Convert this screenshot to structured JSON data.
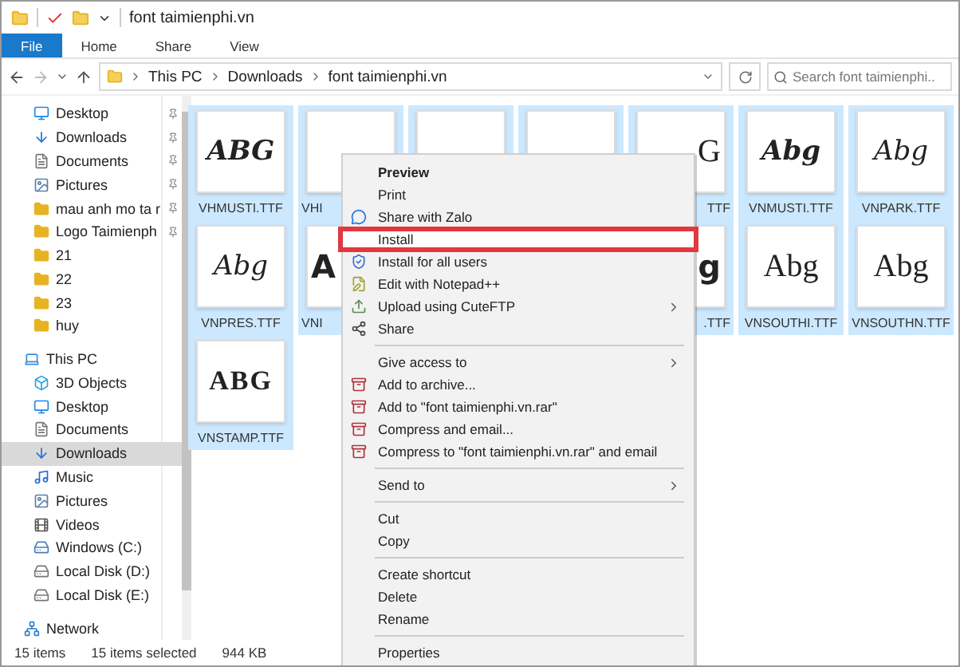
{
  "window": {
    "title": "font taimienphi.vn"
  },
  "ribbon_tabs": [
    {
      "label": "File",
      "kind": "file"
    },
    {
      "label": "Home",
      "kind": "tab"
    },
    {
      "label": "Share",
      "kind": "tab"
    },
    {
      "label": "View",
      "kind": "tab"
    }
  ],
  "address": {
    "crumbs": [
      "This PC",
      "Downloads",
      "font taimienphi.vn"
    ]
  },
  "search": {
    "placeholder": "Search font taimienphi..."
  },
  "sidebar": {
    "quick_access": [
      {
        "label": "Desktop",
        "kind": "desktop",
        "pinned": true
      },
      {
        "label": "Downloads",
        "kind": "download",
        "pinned": true
      },
      {
        "label": "Documents",
        "kind": "document",
        "pinned": true
      },
      {
        "label": "Pictures",
        "kind": "picture",
        "pinned": true
      },
      {
        "label": "mau anh mo ta r",
        "kind": "folder-image",
        "pinned": true
      },
      {
        "label": "Logo Taimienph",
        "kind": "folder-image",
        "pinned": true
      },
      {
        "label": "21",
        "kind": "folder",
        "pinned": false
      },
      {
        "label": "22",
        "kind": "folder",
        "pinned": false
      },
      {
        "label": "23",
        "kind": "folder",
        "pinned": false
      },
      {
        "label": "huy",
        "kind": "folder",
        "pinned": false
      }
    ],
    "nodes": [
      {
        "label": "This PC",
        "kind": "pc",
        "selected": false,
        "children": [
          {
            "label": "3D Objects",
            "kind": "cube",
            "selected": false
          },
          {
            "label": "Desktop",
            "kind": "desktop",
            "selected": false
          },
          {
            "label": "Documents",
            "kind": "document",
            "selected": false
          },
          {
            "label": "Downloads",
            "kind": "download",
            "selected": true
          },
          {
            "label": "Music",
            "kind": "music",
            "selected": false
          },
          {
            "label": "Pictures",
            "kind": "picture",
            "selected": false
          },
          {
            "label": "Videos",
            "kind": "video",
            "selected": false
          },
          {
            "label": "Windows (C:)",
            "kind": "system-drive",
            "selected": false
          },
          {
            "label": "Local Disk (D:)",
            "kind": "drive",
            "selected": false
          },
          {
            "label": "Local Disk (E:)",
            "kind": "drive",
            "selected": false
          }
        ]
      },
      {
        "label": "Network",
        "kind": "network",
        "selected": false
      }
    ]
  },
  "files": [
    {
      "label": "VHMUSTI.TTF",
      "preview": "ABG",
      "kind": "script-bold",
      "selected": true
    },
    {
      "label": "VHI",
      "selected": true
    },
    {
      "selected": true
    },
    {
      "selected": true
    },
    {
      "label": "TTF",
      "preview": "G",
      "kind": "serif",
      "selected": true
    },
    {
      "label": "VNMUSTI.TTF",
      "preview": "Abg",
      "kind": "script-bold",
      "selected": true
    },
    {
      "label": "VNPARK.TTF",
      "preview": "Abg",
      "kind": "script",
      "selected": true
    },
    {
      "label": "VNPRES.TTF",
      "preview": "Abg",
      "kind": "script",
      "selected": true
    },
    {
      "label": "VNI",
      "preview": "A",
      "kind": "bold",
      "selected": true
    },
    {
      "kind": "covered"
    },
    {
      "kind": "covered"
    },
    {
      "label": ".TTF",
      "preview": "g",
      "kind": "bold",
      "selected": true
    },
    {
      "label": "VNSOUTHI.TTF",
      "preview": "Abg",
      "kind": "serif",
      "selected": true
    },
    {
      "label": "VNSOUTHN.TTF",
      "preview": "Abg",
      "kind": "serif",
      "selected": true
    },
    {
      "label": "VNSTAMP.TTF",
      "preview": "ABG",
      "kind": "stamp",
      "selected": true
    }
  ],
  "context_menu": [
    {
      "kind": "item",
      "label": "Preview",
      "bold": true
    },
    {
      "kind": "item",
      "label": "Print"
    },
    {
      "kind": "item",
      "label": "Share with Zalo"
    },
    {
      "kind": "item",
      "label": "Install",
      "highlighted": true
    },
    {
      "kind": "item",
      "label": "Install for all users"
    },
    {
      "kind": "item",
      "label": "Edit with Notepad++"
    },
    {
      "kind": "item",
      "label": "Upload using CuteFTP",
      "submenu": true
    },
    {
      "kind": "item",
      "label": "Share"
    },
    {
      "kind": "separator"
    },
    {
      "kind": "item",
      "label": "Give access to",
      "submenu": true
    },
    {
      "kind": "item",
      "label": "Add to archive..."
    },
    {
      "kind": "item",
      "label": "Add to \"font taimienphi.vn.rar\""
    },
    {
      "kind": "item",
      "label": "Compress and email..."
    },
    {
      "kind": "item",
      "label": "Compress to \"font taimienphi.vn.rar\" and email"
    },
    {
      "kind": "separator"
    },
    {
      "kind": "item",
      "label": "Send to",
      "submenu": true
    },
    {
      "kind": "separator"
    },
    {
      "kind": "item",
      "label": "Cut"
    },
    {
      "kind": "item",
      "label": "Copy"
    },
    {
      "kind": "separator"
    },
    {
      "kind": "item",
      "label": "Create shortcut"
    },
    {
      "kind": "item",
      "label": "Delete"
    },
    {
      "kind": "item",
      "label": "Rename"
    },
    {
      "kind": "separator"
    },
    {
      "kind": "item",
      "label": "Properties"
    }
  ],
  "status_bar": {
    "count": "15 items",
    "selected": "15 items selected",
    "size": "944 KB"
  }
}
